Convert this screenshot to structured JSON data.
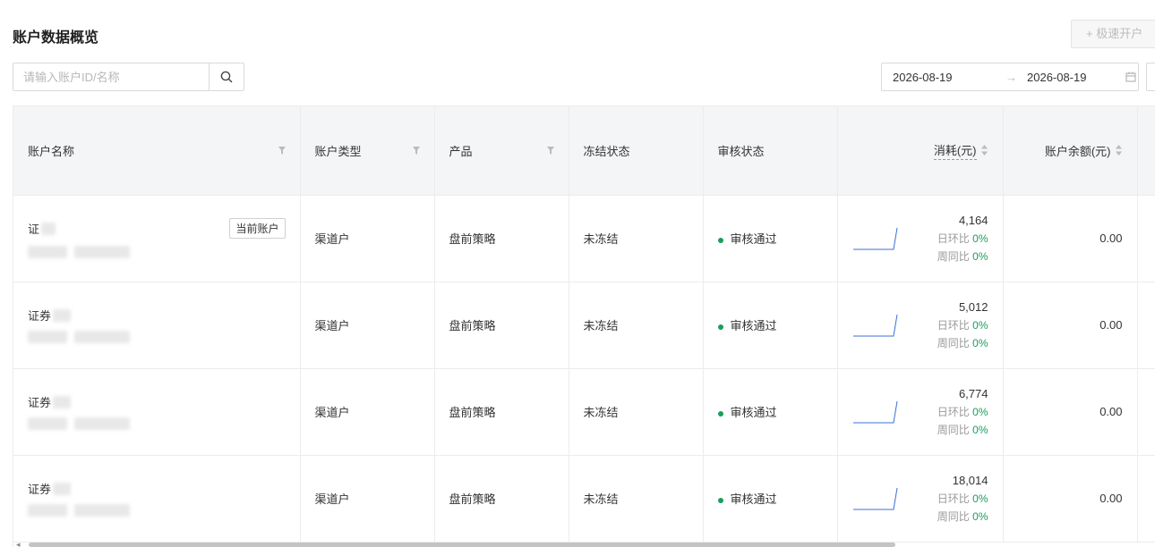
{
  "page": {
    "title": "账户数据概览",
    "create_button": "+ 极速开户"
  },
  "filters": {
    "search_placeholder": "请输入账户ID/名称",
    "date_start": "2026-08-19",
    "date_separator": "→",
    "date_end": "2026-08-19"
  },
  "table": {
    "columns": {
      "account_name": "账户名称",
      "account_type": "账户类型",
      "product": "产品",
      "freeze_status": "冻结状态",
      "review_status": "审核状态",
      "cost": "消耗(元)",
      "balance": "账户余额(元)"
    },
    "current_tag": "当前账户",
    "day_label": "日环比",
    "week_label": "周同比",
    "rows": [
      {
        "name_prefix": "证",
        "account_type": "渠道户",
        "product": "盘前策略",
        "freeze_status": "未冻结",
        "review_status": "审核通过",
        "cost": "4,164",
        "day_ratio": "0%",
        "week_ratio": "0%",
        "balance": "0.00",
        "is_current": true
      },
      {
        "name_prefix": "证券",
        "account_type": "渠道户",
        "product": "盘前策略",
        "freeze_status": "未冻结",
        "review_status": "审核通过",
        "cost": "5,012",
        "day_ratio": "0%",
        "week_ratio": "0%",
        "balance": "0.00",
        "is_current": false
      },
      {
        "name_prefix": "证券",
        "account_type": "渠道户",
        "product": "盘前策略",
        "freeze_status": "未冻结",
        "review_status": "审核通过",
        "cost": "6,774",
        "day_ratio": "0%",
        "week_ratio": "0%",
        "balance": "0.00",
        "is_current": false
      },
      {
        "name_prefix": "证券",
        "account_type": "渠道户",
        "product": "盘前策略",
        "freeze_status": "未冻结",
        "review_status": "审核通过",
        "cost": "18,014",
        "day_ratio": "0%",
        "week_ratio": "0%",
        "balance": "0.00",
        "is_current": false
      }
    ]
  },
  "colors": {
    "accent_green": "#1a9e5a",
    "sparkline_blue": "#3b6fd8"
  }
}
